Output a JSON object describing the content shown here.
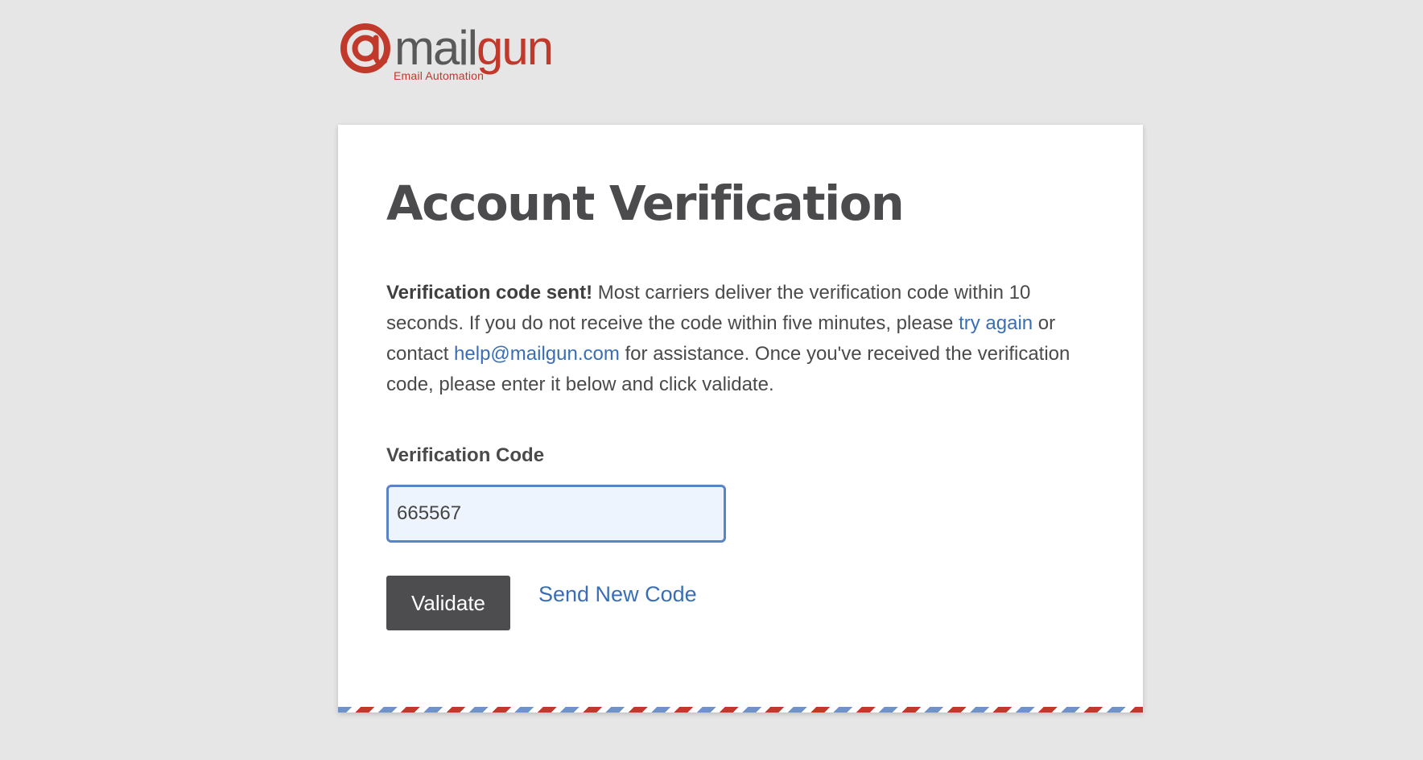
{
  "brand": {
    "logo_word_mail": "mail",
    "logo_word_gun": "gun",
    "tagline": "Email Automation",
    "logo_icon": "at-sign-icon",
    "color_primary": "#c0392b",
    "color_text": "#595959"
  },
  "card": {
    "title": "Account Verification",
    "message": {
      "bold_lead": "Verification code sent!",
      "text_1": " Most carriers deliver the verification code within 10 seconds. If you do not receive the code within five minutes, please ",
      "try_again_link": "try again",
      "text_2": " or contact ",
      "email_link": "help@mailgun.com",
      "text_3": " for assistance. Once you've received the verification code, please enter it below and click validate."
    },
    "field_label": "Verification Code",
    "field_value": "665567",
    "validate_label": "Validate",
    "send_new_label": "Send New Code"
  },
  "colors": {
    "link": "#3a6eb4",
    "button_bg": "#4d4d4f",
    "input_border": "#5b84c4",
    "input_bg": "#eef4fd",
    "airmail_red": "#c0392b",
    "airmail_blue": "#6f93c8"
  }
}
